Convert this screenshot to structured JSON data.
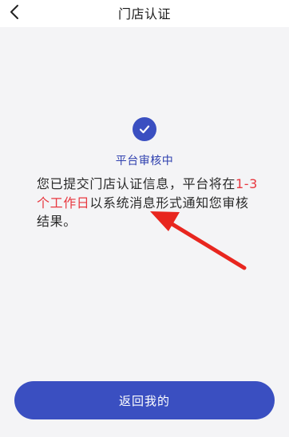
{
  "nav": {
    "title": "门店认证",
    "back_icon": "chevron-left-icon"
  },
  "status": {
    "icon": "check-circle-icon",
    "title": "平台审核中"
  },
  "message": {
    "part1": "您已提交门店认证信息，平台将在",
    "highlight_a": "1-3",
    "highlight_b": "个工作日",
    "part2": "以系统消息形式通知您审核结果。"
  },
  "annotation": {
    "icon": "red-arrow"
  },
  "actions": {
    "return_label": "返回我的"
  },
  "colors": {
    "accent": "#3a4fc1",
    "highlight": "#e8373f",
    "background": "#f4f4f6",
    "annotation": "#e8261f"
  }
}
